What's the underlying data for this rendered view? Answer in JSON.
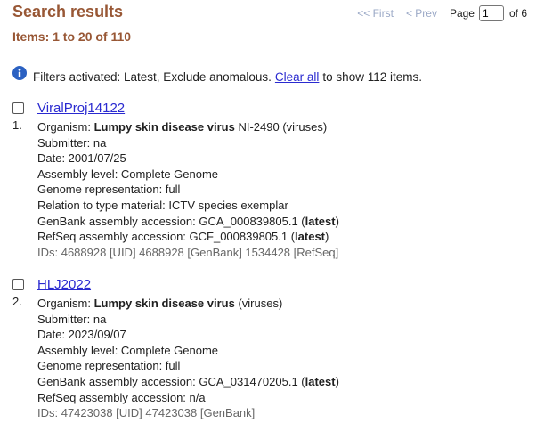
{
  "header": {
    "title": "Search results",
    "items_count": "Items: 1 to 20 of 110"
  },
  "pager": {
    "first": "<< First",
    "prev": "< Prev",
    "page_label": "Page",
    "current_page": "1",
    "of_label": "of 6"
  },
  "filters": {
    "prefix": "Filters activated: Latest, Exclude anomalous.",
    "clear_link": "Clear all",
    "suffix": "to show 112 items."
  },
  "results": [
    {
      "number": "1.",
      "title": "ViralProj14122",
      "organism_label": "Organism:",
      "organism_name": "Lumpy skin disease virus",
      "organism_rest": "NI-2490 (viruses)",
      "submitter": "Submitter: na",
      "date": "Date: 2001/07/25",
      "assembly_level": "Assembly level: Complete Genome",
      "genome_rep": "Genome representation: full",
      "type_material": "Relation to type material: ICTV species exemplar",
      "genbank_prefix": "GenBank assembly accession: GCA_000839805.1 (",
      "genbank_bold": "latest",
      "genbank_suffix": ")",
      "refseq_prefix": "RefSeq assembly accession: GCF_000839805.1 (",
      "refseq_bold": "latest",
      "refseq_suffix": ")",
      "ids": "IDs: 4688928 [UID] 4688928 [GenBank] 1534428 [RefSeq]"
    },
    {
      "number": "2.",
      "title": "HLJ2022",
      "organism_label": "Organism:",
      "organism_name": "Lumpy skin disease virus",
      "organism_rest": "(viruses)",
      "submitter": "Submitter: na",
      "date": "Date: 2023/09/07",
      "assembly_level": "Assembly level: Complete Genome",
      "genome_rep": "Genome representation: full",
      "genbank_prefix": "GenBank assembly accession: GCA_031470205.1 (",
      "genbank_bold": "latest",
      "genbank_suffix": ")",
      "refseq_text": "RefSeq assembly accession: n/a",
      "ids": "IDs: 47423038 [UID] 47423038 [GenBank]"
    }
  ]
}
